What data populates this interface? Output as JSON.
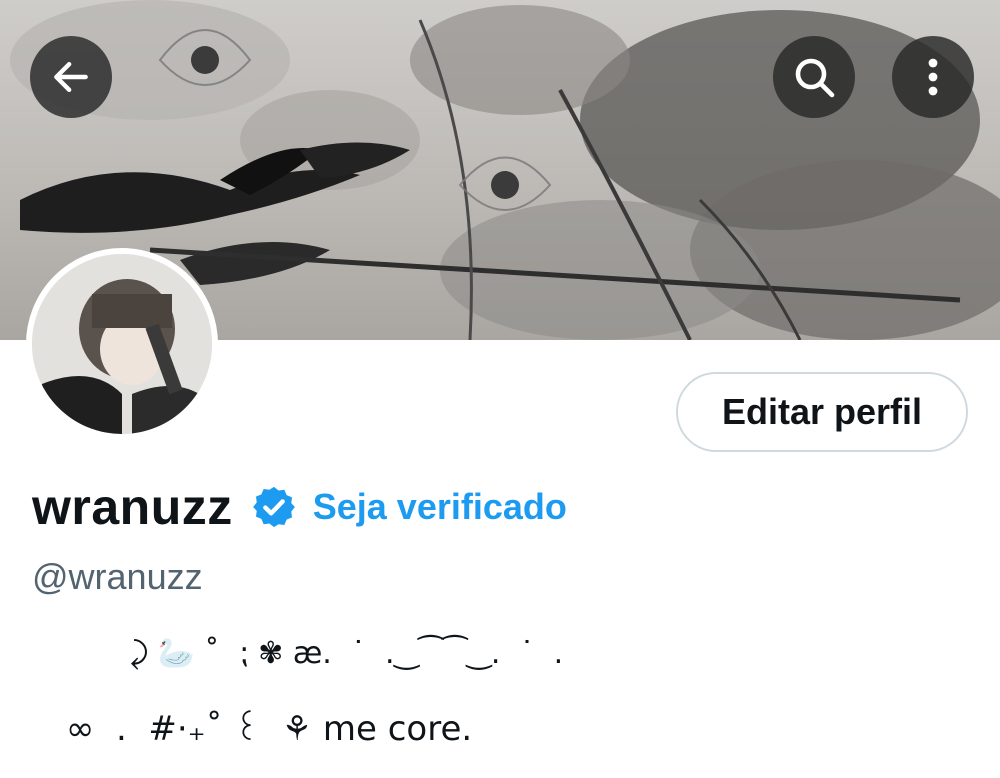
{
  "header": {
    "back_icon": "arrow-left-icon",
    "search_icon": "search-icon",
    "more_icon": "more-vertical-icon"
  },
  "profile": {
    "display_name": "wranuzz",
    "verified_icon": "verified-badge-icon",
    "get_verified_label": "Seja verificado",
    "handle": "@wranuzz",
    "edit_button_label": "Editar perfil",
    "bio_line_1": "⤸ 🦢 ˚  ⁏ ✾ æ.  ˙  .‿⁀⁀‿.  ˙  .",
    "bio_line_2": "∞  .  #·₊˚ ꒰  ⚘ me core."
  },
  "colors": {
    "accent": "#1d9bf0",
    "text_primary": "#0f1419",
    "text_secondary": "#536471",
    "button_border": "#cfd9de"
  }
}
